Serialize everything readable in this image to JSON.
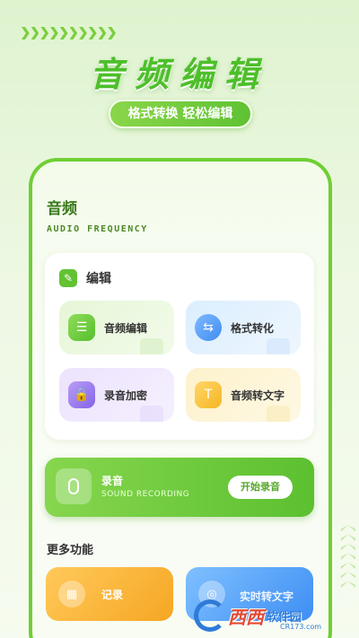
{
  "hero": {
    "title": "音频编辑",
    "tagline": "格式转换 轻松编辑"
  },
  "card": {
    "title": "音频",
    "subtitle": "AUDIO FREQUENCY"
  },
  "edit": {
    "header": "编辑",
    "tiles": [
      {
        "label": "音频编辑",
        "icon": "audio-edit-icon"
      },
      {
        "label": "格式转化",
        "icon": "format-convert-icon"
      },
      {
        "label": "录音加密",
        "icon": "lock-icon"
      },
      {
        "label": "音频转文字",
        "icon": "audio-to-text-icon"
      }
    ]
  },
  "record": {
    "title": "录音",
    "subtitle": "SOUND RECORDING",
    "button": "开始录音"
  },
  "more": {
    "title": "更多功能",
    "items": [
      {
        "label": "记录",
        "icon": "calendar-icon"
      },
      {
        "label": "实时转文字",
        "icon": "realtime-text-icon"
      }
    ]
  },
  "watermark": {
    "brand": "西西",
    "text": "软件园",
    "url": "CR173.com"
  },
  "colors": {
    "accent": "#5cc030",
    "frame": "#6fcf34",
    "orange": "#f6a623",
    "blue": "#3e8ef3",
    "purple": "#8464e6",
    "yellow": "#f5b522"
  }
}
